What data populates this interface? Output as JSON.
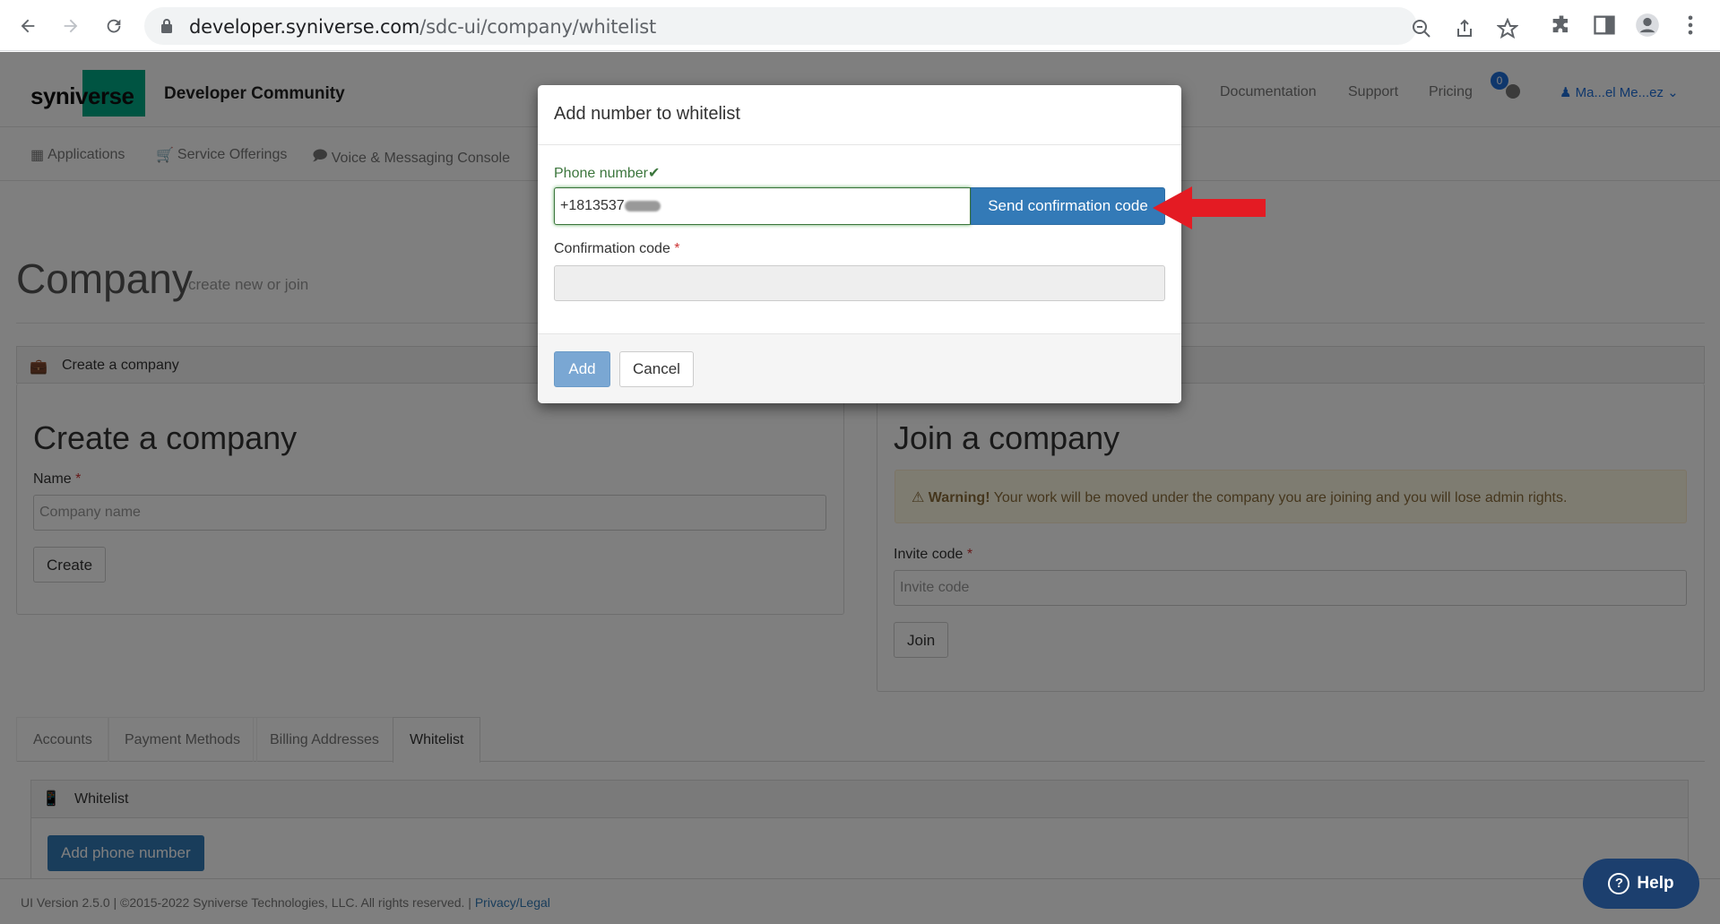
{
  "browser": {
    "url_host": "developer.syniverse.com",
    "url_path": "/sdc-ui/company/whitelist"
  },
  "header": {
    "logo_text": "syniverse",
    "site_title": "Developer Community",
    "links": [
      "Documentation",
      "Support",
      "Pricing"
    ],
    "notification_count": "0",
    "user_name": "Ma...el Me...ez"
  },
  "subnav": {
    "items": [
      "Applications",
      "Service Offerings",
      "Voice & Messaging Console"
    ]
  },
  "company": {
    "title": "Company",
    "subtitle": "create new or join"
  },
  "create_panel": {
    "head": "Create a company",
    "title": "Create a company",
    "name_label": "Name",
    "name_placeholder": "Company name",
    "create_button": "Create"
  },
  "join_panel": {
    "title": "Join a company",
    "warning_strong": "Warning!",
    "warning_text": " Your work will be moved under the company you are joining and you will lose admin rights.",
    "invite_label": "Invite code",
    "invite_placeholder": "Invite code",
    "join_button": "Join"
  },
  "tabs": [
    "Accounts",
    "Payment Methods",
    "Billing Addresses",
    "Whitelist"
  ],
  "whitelist": {
    "head": "Whitelist",
    "add_button": "Add phone number"
  },
  "footer": {
    "text": "UI Version 2.5.0 | ©2015-2022 Syniverse Technologies, LLC. All rights reserved. | ",
    "link": "Privacy/Legal"
  },
  "help": {
    "label": "Help"
  },
  "modal": {
    "title": "Add number to whitelist",
    "phone_label": "Phone number",
    "phone_value": "+1813537",
    "send_button": "Send confirmation code",
    "code_label": "Confirmation code",
    "add_button": "Add",
    "cancel_button": "Cancel"
  },
  "colors": {
    "primary": "#337ab7",
    "success": "#3c763d",
    "brand_green": "#00a885",
    "arrow": "#e41b23"
  }
}
